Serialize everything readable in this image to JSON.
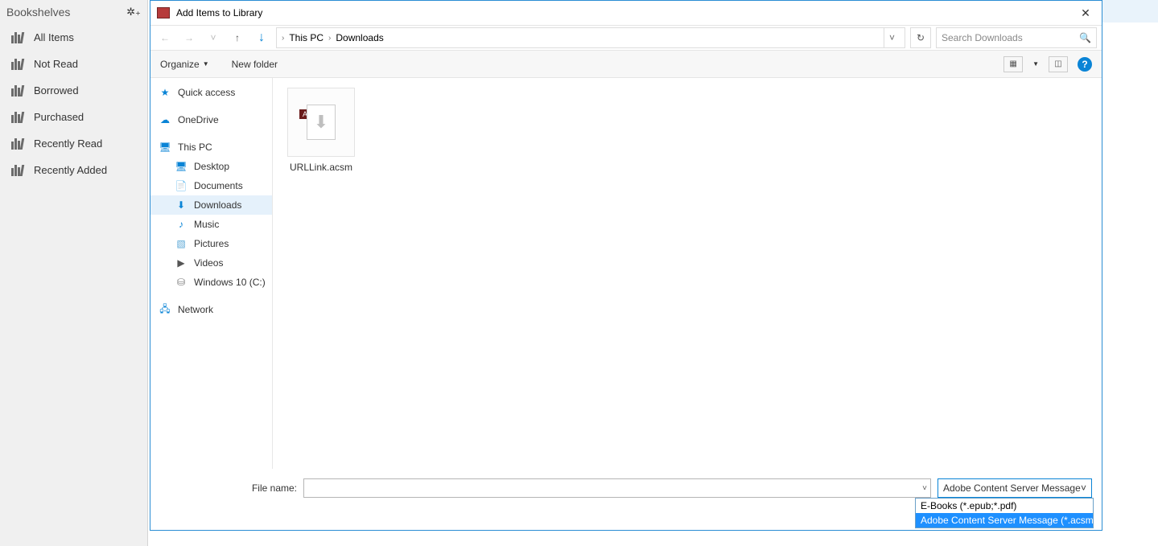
{
  "library": {
    "title": "Bookshelves",
    "gear_icon": "gear",
    "items": [
      {
        "label": "All Items"
      },
      {
        "label": "Not Read"
      },
      {
        "label": "Borrowed"
      },
      {
        "label": "Purchased"
      },
      {
        "label": "Recently Read"
      },
      {
        "label": "Recently Added"
      }
    ]
  },
  "dialog": {
    "title": "Add Items to Library",
    "close": "✕",
    "nav": {
      "back": "←",
      "forward": "→",
      "recent": "˅",
      "up": "↑",
      "down": "↓"
    },
    "breadcrumb": {
      "root": "This PC",
      "current": "Downloads",
      "chevron": "›"
    },
    "refresh": "↻",
    "search_placeholder": "Search Downloads",
    "toolbar": {
      "organize": "Organize",
      "new_folder": "New folder",
      "help": "?"
    },
    "tree": {
      "quick_access": "Quick access",
      "onedrive": "OneDrive",
      "this_pc": "This PC",
      "desktop": "Desktop",
      "documents": "Documents",
      "downloads": "Downloads",
      "music": "Music",
      "pictures": "Pictures",
      "videos": "Videos",
      "drive_c": "Windows 10 (C:)",
      "network": "Network"
    },
    "files": [
      {
        "name": "URLLink.acsm",
        "badge": "ACSM"
      }
    ],
    "filename_label": "File name:",
    "filename_value": "",
    "filetype_selected": "Adobe Content Server Message",
    "filetype_options": [
      "E-Books  (*.epub;*.pdf)",
      "Adobe Content Server Message (*.acsm)"
    ]
  }
}
